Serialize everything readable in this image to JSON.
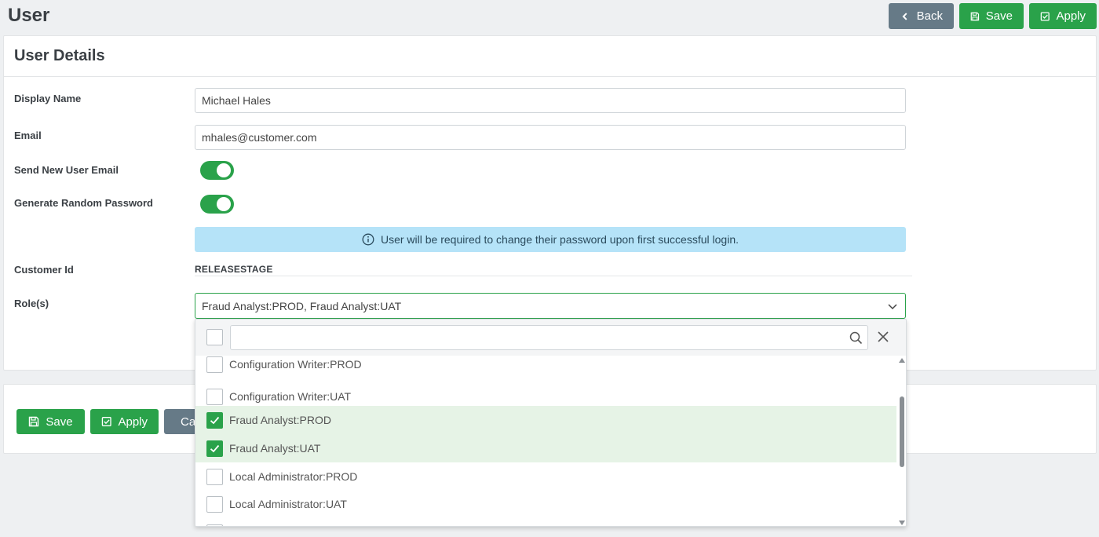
{
  "page": {
    "title": "User"
  },
  "header_actions": {
    "back_label": "Back",
    "save_label": "Save",
    "apply_label": "Apply"
  },
  "details": {
    "title": "User Details",
    "display_name": {
      "label": "Display Name",
      "value": "Michael Hales"
    },
    "email": {
      "label": "Email",
      "value": "mhales@customer.com"
    },
    "send_new_user_email": {
      "label": "Send New User Email",
      "enabled": true
    },
    "generate_random_password": {
      "label": "Generate Random Password",
      "enabled": true
    },
    "info_message": "User will be required to change their password upon first successful login.",
    "customer_id": {
      "label": "Customer Id",
      "value": "RELEASESTAGE"
    },
    "roles": {
      "label": "Role(s)",
      "value": "Fraud Analyst:PROD, Fraud Analyst:UAT"
    }
  },
  "bottom_actions": {
    "save_label": "Save",
    "apply_label": "Apply",
    "cancel_label": "Ca"
  },
  "roles_dropdown": {
    "search_value": "",
    "options": [
      {
        "label": "Configuration Writer:PROD",
        "checked": false
      },
      {
        "label": "Configuration Writer:UAT",
        "checked": false
      },
      {
        "label": "Fraud Analyst:PROD",
        "checked": true
      },
      {
        "label": "Fraud Analyst:UAT",
        "checked": true
      },
      {
        "label": "Local Administrator:PROD",
        "checked": false
      },
      {
        "label": "Local Administrator:UAT",
        "checked": false
      }
    ]
  },
  "colors": {
    "primary_green": "#2aa24a",
    "back_grey": "#667a87",
    "info_blue": "#b5e3f8",
    "selected_row": "#e6f3e6"
  }
}
